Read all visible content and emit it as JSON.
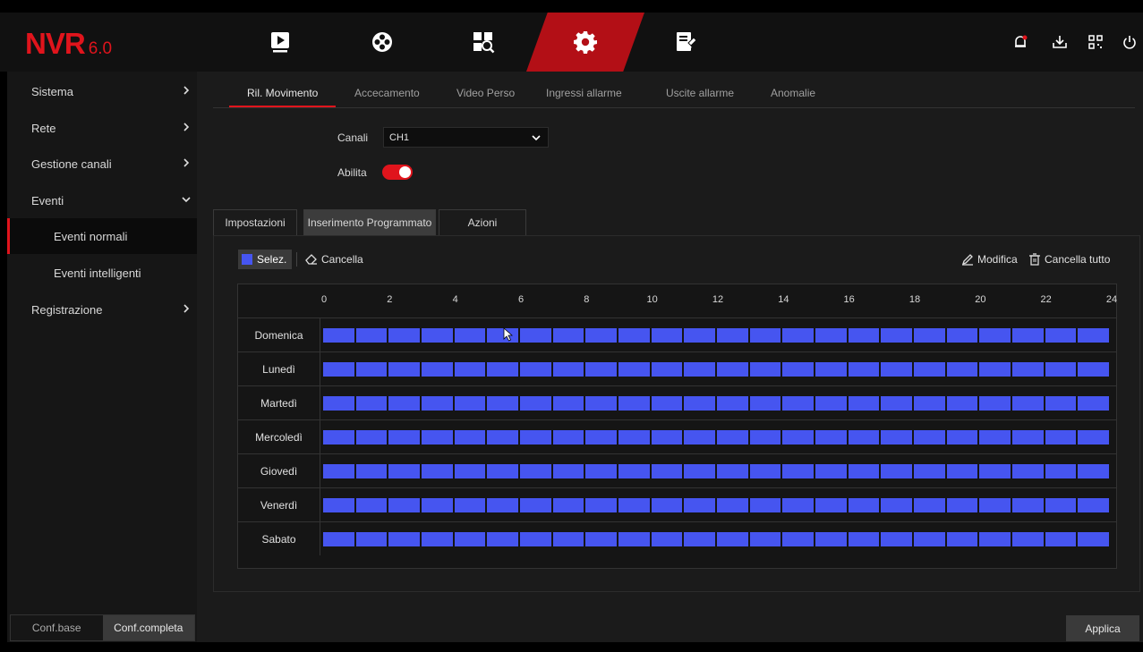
{
  "app": {
    "logo_main": "NVR",
    "logo_version": "6.0"
  },
  "topnav": {
    "items": [
      {
        "icon": "live-view-icon",
        "active": false
      },
      {
        "icon": "playback-icon",
        "active": false
      },
      {
        "icon": "search-icon",
        "active": false
      },
      {
        "icon": "gear-icon",
        "active": true
      },
      {
        "icon": "maintenance-icon",
        "active": false
      }
    ],
    "right_icons": [
      "alarm-bell-icon",
      "download-icon",
      "qr-code-icon",
      "power-icon"
    ],
    "active_color": "#b30f16"
  },
  "sidebar": {
    "items": [
      {
        "label": "Sistema",
        "chevron": "right"
      },
      {
        "label": "Rete",
        "chevron": "right"
      },
      {
        "label": "Gestione canali",
        "chevron": "right"
      },
      {
        "label": "Eventi",
        "chevron": "down"
      },
      {
        "label": "Eventi normali",
        "sub": true,
        "active": true
      },
      {
        "label": "Eventi intelligenti",
        "sub": true
      },
      {
        "label": "Registrazione",
        "chevron": "right"
      }
    ],
    "conf_base": "Conf.base",
    "conf_full": "Conf.completa"
  },
  "event_tabs": [
    "Ril. Movimento",
    "Accecamento",
    "Video Perso",
    "Ingressi allarme",
    "Uscite allarme",
    "Anomalie"
  ],
  "event_tab_active": 0,
  "form": {
    "channel_label": "Canali",
    "channel_value": "CH1",
    "enable_label": "Abilita",
    "enable_on": true
  },
  "sub_tabs": [
    "Impostazioni",
    "Inserimento Programmato",
    "Azioni"
  ],
  "sub_tab_active": 1,
  "toolbar": {
    "select_label": "Selez.",
    "erase_label": "Cancella",
    "modify_label": "Modifica",
    "clear_all_label": "Cancella tutto"
  },
  "schedule": {
    "hour_labels": [
      "0",
      "2",
      "4",
      "6",
      "8",
      "10",
      "12",
      "14",
      "16",
      "18",
      "20",
      "22",
      "24"
    ],
    "days": [
      "Domenica",
      "Lunedì",
      "Martedì",
      "Mercoledì",
      "Giovedì",
      "Venerdì",
      "Sabato"
    ],
    "slot_color": "#4655f0",
    "all_hours_selected": true
  },
  "apply_label": "Applica",
  "accent_color": "#e0141c"
}
